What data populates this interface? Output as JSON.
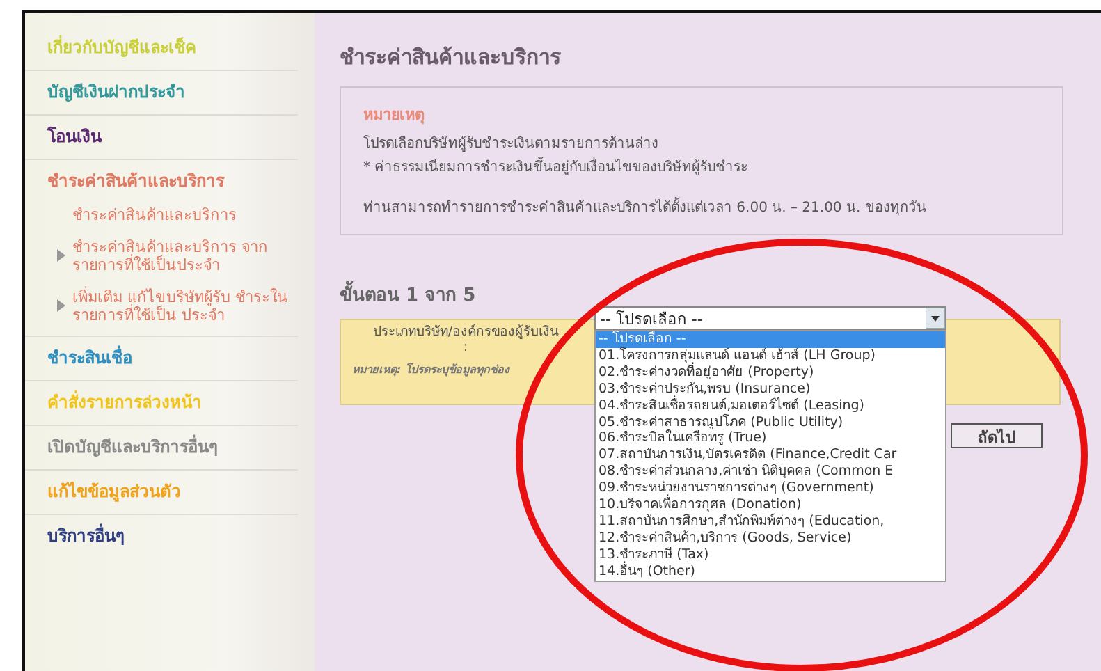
{
  "sidebar": {
    "items": [
      {
        "label": "เกี่ยวกับบัญชีและเช็ค",
        "color": "#c9cf3c"
      },
      {
        "label": "บัญชีเงินฝากประจำ",
        "color": "#33999c"
      },
      {
        "label": "โอนเงิน",
        "color": "#5b2a72"
      },
      {
        "label": "ชำระค่าสินค้าและบริการ",
        "color": "#e07a64",
        "children": [
          {
            "label": "ชำระค่าสินค้าและบริการ",
            "expandable": false
          },
          {
            "label": "ชำระค่าสินค้าและบริการ จากรายการที่ใช้เป็นประจำ",
            "expandable": true
          },
          {
            "label": "เพิ่มเติม แก้ไขบริษัทผู้รับ ชำระในรายการที่ใช้เป็น ประจำ",
            "expandable": true
          }
        ]
      },
      {
        "label": "ชำระสินเชื่อ",
        "color": "#2f8fc0"
      },
      {
        "label": "คำสั่งรายการล่วงหน้า",
        "color": "#f0c41c"
      },
      {
        "label": "เปิดบัญชีและบริการอื่นๆ",
        "color": "#8a8a8a"
      },
      {
        "label": "แก้ไขข้อมูลส่วนตัว",
        "color": "#f0a21c"
      },
      {
        "label": "บริการอื่นๆ",
        "color": "#2f3f80"
      }
    ]
  },
  "page_title": "ชำระค่าสินค้าและบริการ",
  "notice": {
    "heading": "หมายเหตุ",
    "lines": [
      "โปรดเลือกบริษัทผู้รับชำระเงินตามรายการด้านล่าง",
      "* ค่าธรรมเนียมการชำระเงินขึ้นอยู่กับเงื่อนไขของบริษัทผู้รับชำระ"
    ],
    "hours": "ท่านสามารถทำรายการชำระค่าสินค้าและบริการได้ตั้งแต่เวลา 6.00 น. – 21.00 น. ของทุกวัน"
  },
  "step": "ขั้นตอน 1 จาก 5",
  "form": {
    "label": "ประเภทบริษัท/องค์กรของผู้รับเงิน :",
    "note": "หมายเหตุ: โปรดระบุข้อมูลทุกช่อง",
    "select": {
      "value": "-- โปรดเลือก --",
      "expanded": true,
      "options": [
        {
          "label": "-- โปรดเลือก --",
          "selected": true
        },
        {
          "label": "01.โครงการกลุ่มแลนด์ แอนด์ เฮ้าส์ (LH Group)",
          "selected": false
        },
        {
          "label": "02.ชำระค่างวดที่อยู่อาศัย (Property)",
          "selected": false
        },
        {
          "label": "03.ชำระค่าประกัน,พรบ (Insurance)",
          "selected": false
        },
        {
          "label": "04.ชำระสินเชื่อรถยนต์,มอเตอร์ไซต์ (Leasing)",
          "selected": false
        },
        {
          "label": "05.ชำระค่าสาธารณูปโภค (Public Utility)",
          "selected": false
        },
        {
          "label": "06.ชำระบิลในเครือทรู (True)",
          "selected": false
        },
        {
          "label": "07.สถาบันการเงิน,บัตรเครดิต (Finance,Credit Car",
          "selected": false
        },
        {
          "label": "08.ชำระค่าส่วนกลาง,ค่าเช่า นิติบุคคล (Common E",
          "selected": false
        },
        {
          "label": "09.ชำระหน่วยงานราชการต่างๆ (Government)",
          "selected": false
        },
        {
          "label": "10.บริจาคเพื่อการกุศล (Donation)",
          "selected": false
        },
        {
          "label": "11.สถาบันการศึกษา,สำนักพิมพ์ต่างๆ (Education,",
          "selected": false
        },
        {
          "label": "12.ชำระค่าสินค้า,บริการ (Goods, Service)",
          "selected": false
        },
        {
          "label": "13.ชำระภาษี (Tax)",
          "selected": false
        },
        {
          "label": "14.อื่นๆ (Other)",
          "selected": false
        }
      ]
    }
  },
  "next_button": "ถัดไป"
}
